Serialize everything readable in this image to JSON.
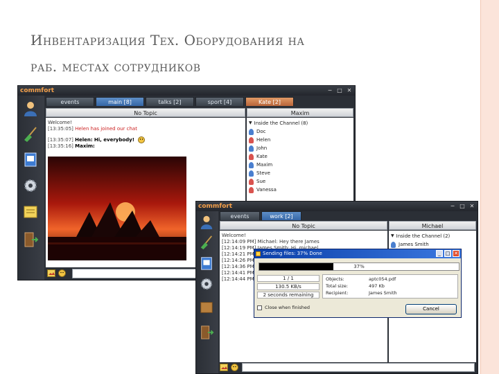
{
  "slide": {
    "title_line1": "Инвентаризация Тех. Оборудования на",
    "title_line2": "раб. местах сотрудников"
  },
  "window1": {
    "logo": "commfort",
    "tabs": [
      {
        "label": "events",
        "state": "normal"
      },
      {
        "label": "main [8]",
        "state": "active"
      },
      {
        "label": "talks [2]",
        "state": "normal"
      },
      {
        "label": "sport [4]",
        "state": "normal"
      },
      {
        "label": "Kate [2]",
        "state": "highlight"
      }
    ],
    "topic": "No Topic",
    "user_header": "Maxim",
    "chat": [
      {
        "ts": "Welcome!",
        "name": "",
        "text": ""
      },
      {
        "ts": "[13:35:05]",
        "name": "Helen",
        "text": "has joined our chat"
      },
      {
        "ts": "[13:35:07]",
        "name": "Helen:",
        "text": "Hi, everybody!"
      },
      {
        "ts": "[13:35:16]",
        "name": "Maxim:",
        "text": ""
      }
    ],
    "channel_label": "Inside the Channel (8)",
    "users": [
      "Doc",
      "Helen",
      "John",
      "Kate",
      "Maxim",
      "Steve",
      "Sue",
      "Vanessa"
    ]
  },
  "window2": {
    "logo": "commfort",
    "tabs": [
      {
        "label": "events",
        "state": "normal"
      },
      {
        "label": "work [2]",
        "state": "active"
      }
    ],
    "topic": "No Topic",
    "user_header": "Michael",
    "chat": [
      "Welcome!",
      "[12:14:09 PM] Michael: Hey there James",
      "[12:14:19 PM] James Smith: Hi, michael",
      "[12:14:21 PM]",
      "[12:14:26 PM]",
      "[12:14:36 PM]",
      "[12:14:41 PM]",
      "[12:14:44 PM]"
    ],
    "channel_label": "Inside the Channel (2)",
    "users": [
      "James Smith"
    ]
  },
  "dialog": {
    "title": "Sending files: 37% Done",
    "progress_percent": 37,
    "progress_label": "37%",
    "count": "1 / 1",
    "speed": "130.5 KB/s",
    "remaining": "2 seconds remaining",
    "objects_label": "Objects:",
    "objects_value": "aptc054.pdf",
    "size_label": "Total size:",
    "size_value": "497 Kb",
    "recipient_label": "Recipient:",
    "recipient_value": "James Smith",
    "checkbox_label": "Close when finished",
    "cancel_label": "Cancel"
  }
}
